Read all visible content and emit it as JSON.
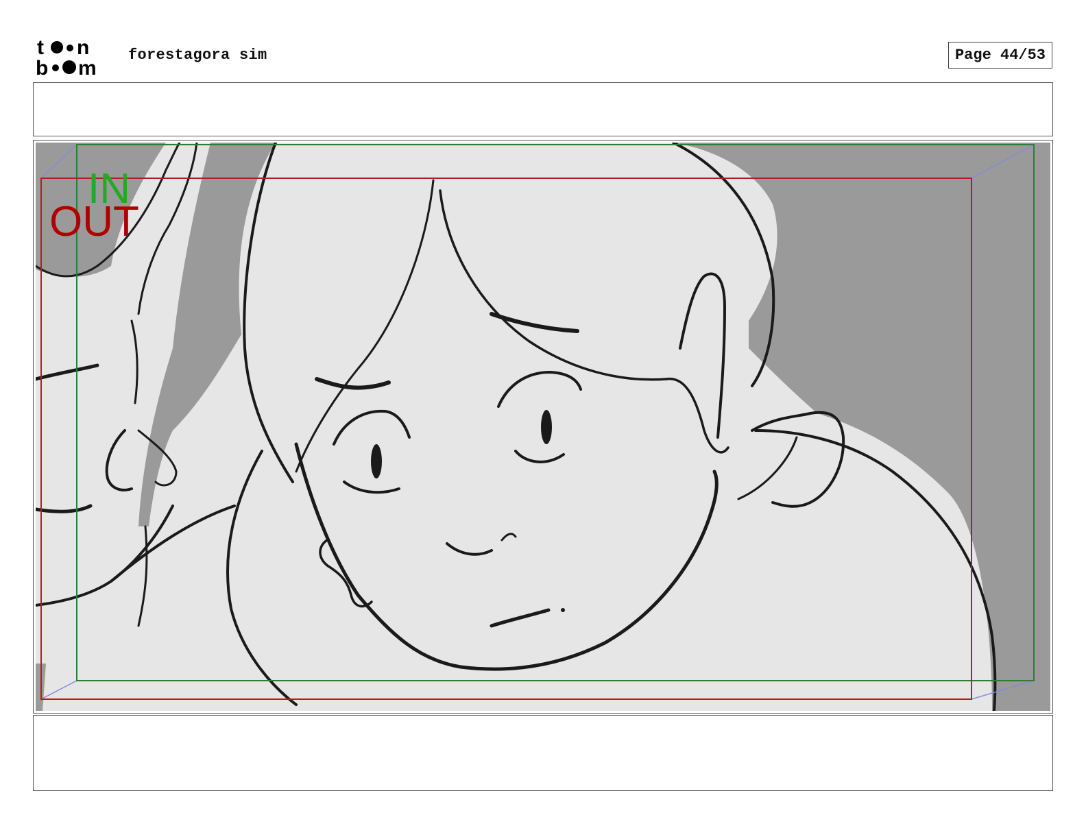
{
  "header": {
    "logo_text": "toon boom",
    "project_title": "forestagora sim",
    "page_label": "Page 44/53"
  },
  "panel": {
    "in_label": "IN",
    "out_label": "OUT",
    "colors": {
      "in_frame": "#2e7d32",
      "out_frame": "#b71c1c",
      "in_text": "#22aa22",
      "out_text": "#b00000",
      "camera_arrows": "#8888dd",
      "background_shadow": "#9a9a9a",
      "character_fill": "#e6e6e6",
      "line_art": "#1a1a1a"
    }
  },
  "action_notes": "",
  "dialogue_notes": ""
}
